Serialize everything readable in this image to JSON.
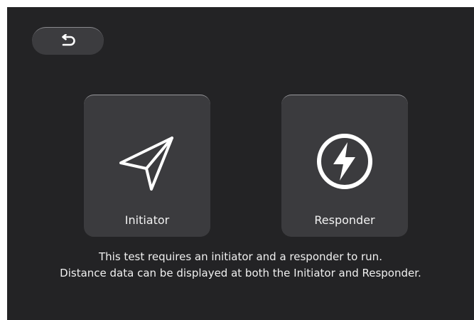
{
  "back_button": {
    "icon": "return-arrow-icon"
  },
  "modes": [
    {
      "label": "Initiator",
      "icon": "paper-plane-icon"
    },
    {
      "label": "Responder",
      "icon": "lightning-bolt-icon"
    }
  ],
  "description": {
    "line1": "This test requires an initiator and a responder to run.",
    "line2": "Distance data can be displayed at both the Initiator and Responder."
  },
  "colors": {
    "background": "#232325",
    "card": "#3b3b3e",
    "text": "#f2f2f2"
  }
}
